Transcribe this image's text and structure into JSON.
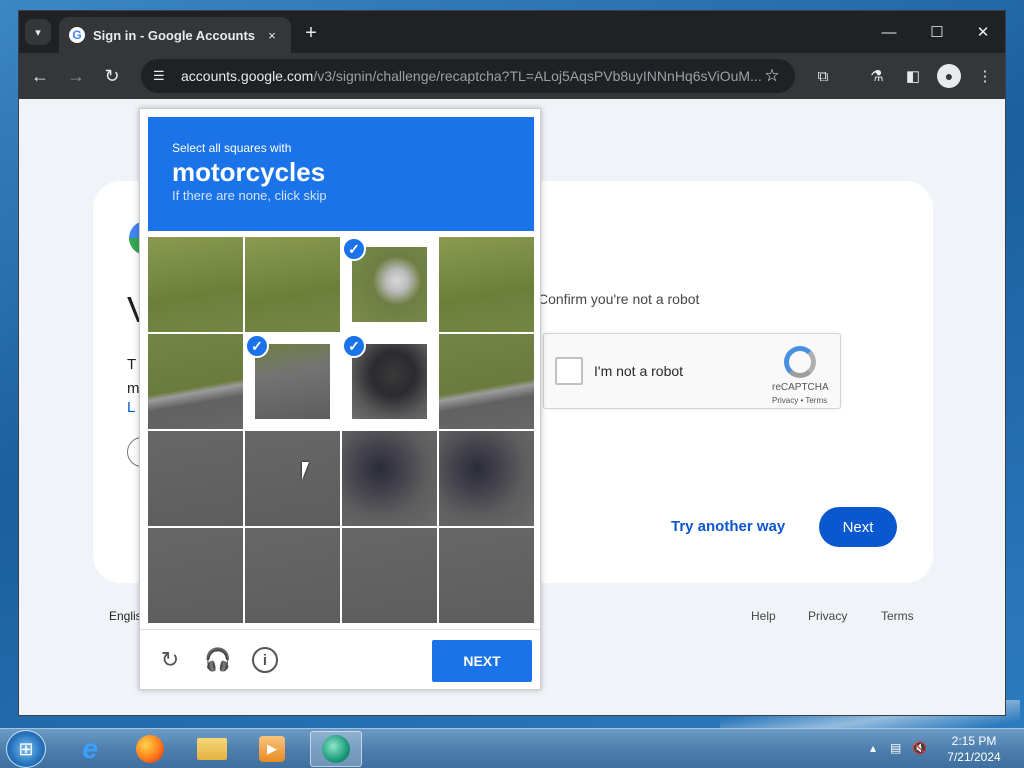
{
  "browser": {
    "tab_title": "Sign in - Google Accounts",
    "tab_close_icon": "×",
    "new_tab_icon": "+",
    "url_host": "accounts.google.com",
    "url_path": "/v3/signin/challenge/recaptcha?TL=ALoj5AqsPVb8uyINNnHq6sViOuM...",
    "window_controls": {
      "minimize": "—",
      "maximize": "☐",
      "close": "✕"
    }
  },
  "signin_card": {
    "confirm_text": "Confirm you're not a robot",
    "try_another_way": "Try another way",
    "next": "Next"
  },
  "recaptcha_checkbox": {
    "label": "I'm not a robot",
    "brand": "reCAPTCHA",
    "terms": "Privacy • Terms"
  },
  "footer": {
    "language": "Englis",
    "help": "Help",
    "privacy": "Privacy",
    "terms": "Terms"
  },
  "challenge": {
    "instruction": "Select all squares with",
    "object": "motorcycles",
    "hint": "If there are none, click skip",
    "next_button": "NEXT",
    "tiles": [
      {
        "row": 1,
        "col": 1,
        "selected": false
      },
      {
        "row": 1,
        "col": 2,
        "selected": false
      },
      {
        "row": 1,
        "col": 3,
        "selected": true
      },
      {
        "row": 1,
        "col": 4,
        "selected": false
      },
      {
        "row": 2,
        "col": 1,
        "selected": false
      },
      {
        "row": 2,
        "col": 2,
        "selected": true
      },
      {
        "row": 2,
        "col": 3,
        "selected": true
      },
      {
        "row": 2,
        "col": 4,
        "selected": false
      },
      {
        "row": 3,
        "col": 1,
        "selected": false
      },
      {
        "row": 3,
        "col": 2,
        "selected": false
      },
      {
        "row": 3,
        "col": 3,
        "selected": false
      },
      {
        "row": 3,
        "col": 4,
        "selected": false
      },
      {
        "row": 4,
        "col": 1,
        "selected": false
      },
      {
        "row": 4,
        "col": 2,
        "selected": false
      },
      {
        "row": 4,
        "col": 3,
        "selected": false
      },
      {
        "row": 4,
        "col": 4,
        "selected": false
      }
    ]
  },
  "taskbar": {
    "time": "2:15 PM",
    "date": "7/21/2024"
  },
  "colors": {
    "accent": "#1a73e8",
    "google_blue": "#0b57d0"
  }
}
